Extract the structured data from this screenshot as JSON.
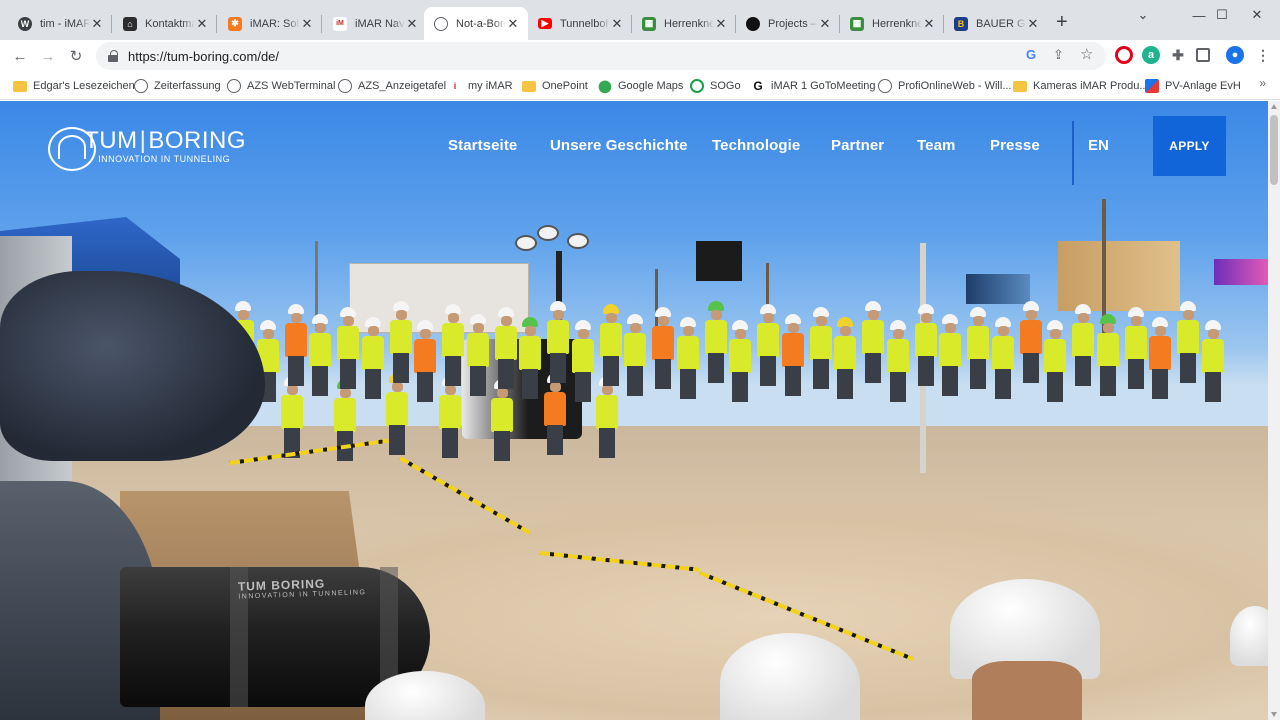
{
  "browser": {
    "tabs": [
      {
        "title": "tim - iMAR",
        "icon": "wordpress-icon",
        "color": "#3c4043"
      },
      {
        "title": "Kontaktma",
        "icon": "joomla-house-icon",
        "color": "#2c2c2c"
      },
      {
        "title": "iMAR: Solu",
        "icon": "joomla-icon",
        "color": "#f47b20"
      },
      {
        "title": "iMAR Navig",
        "icon": "imar-icon",
        "color": "#c62828"
      },
      {
        "title": "Not-a-Bori",
        "icon": "tum-boring-icon",
        "color": "#5f6368",
        "active": true
      },
      {
        "title": "Tunnelboh",
        "icon": "youtube-icon",
        "color": "#ff0000"
      },
      {
        "title": "Herrenkne",
        "icon": "herrenknecht-icon",
        "color": "#3e8e41"
      },
      {
        "title": "Projects —",
        "icon": "projects-icon",
        "color": "#111111"
      },
      {
        "title": "Herrenkne",
        "icon": "herrenknecht-icon",
        "color": "#3e8e41"
      },
      {
        "title": "BAUER Gru",
        "icon": "bauer-icon",
        "color": "#1f3c88"
      }
    ],
    "url": "https://tum-boring.com/de/",
    "bookmarks": [
      {
        "label": "Edgar's Lesezeichen",
        "icon": "folder-icon"
      },
      {
        "label": "Zeiterfassung",
        "icon": "globe-icon"
      },
      {
        "label": "AZS WebTerminal",
        "icon": "globe-icon"
      },
      {
        "label": "AZS_Anzeigetafel",
        "icon": "globe-icon"
      },
      {
        "label": "my iMAR",
        "icon": "imar-icon"
      },
      {
        "label": "OnePoint",
        "icon": "folder-icon"
      },
      {
        "label": "Google Maps",
        "icon": "maps-pin-icon"
      },
      {
        "label": "SOGo",
        "icon": "sogo-icon"
      },
      {
        "label": "iMAR 1 GoToMeeting",
        "icon": "gotomeeting-icon"
      },
      {
        "label": "ProfiOnlineWeb - Will...",
        "icon": "globe-icon"
      },
      {
        "label": "Kameras iMAR Produ...",
        "icon": "folder-icon"
      },
      {
        "label": "PV-Anlage EvH",
        "icon": "pv-icon"
      }
    ],
    "more_bookmarks": "»"
  },
  "site": {
    "logo_tum": "TUM",
    "logo_divider": "|",
    "logo_boring": "BORING",
    "logo_tagline": "INNOVATION IN TUNNELING",
    "nav": [
      "Startseite",
      "Unsere Geschichte",
      "Technologie",
      "Partner",
      "Team",
      "Presse"
    ],
    "language": "EN",
    "apply_label": "APPLY",
    "tube_text": "TUM BORING",
    "tube_subtext": "INNOVATION IN TUNNELING",
    "accent_color": "#1165d9"
  }
}
